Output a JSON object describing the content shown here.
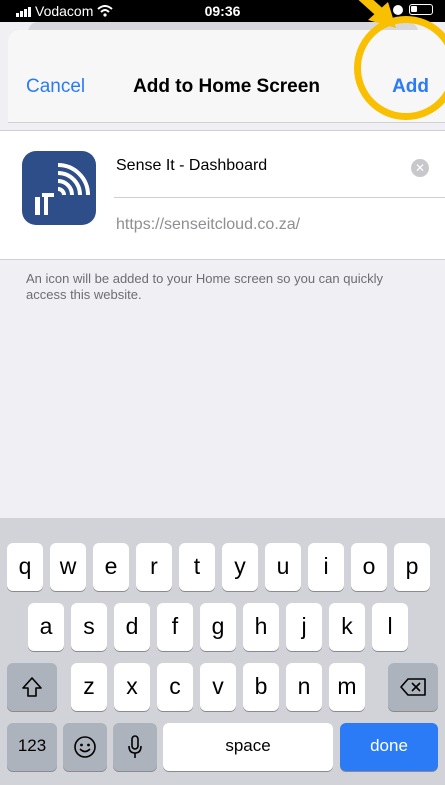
{
  "status_bar": {
    "carrier": "Vodacom",
    "time": "09:36"
  },
  "navbar": {
    "cancel_label": "Cancel",
    "title": "Add to Home Screen",
    "add_label": "Add"
  },
  "form": {
    "name_value": "Sense It - Dashboard",
    "url_value": "https://senseitcloud.co.za/",
    "note": "An icon will be added to your Home screen so you can quickly access this website."
  },
  "icons": {
    "app": "sense-it-wifi-logo",
    "clear": "clear-icon",
    "shift": "shift-icon",
    "backspace": "backspace-icon",
    "emoji": "emoji-icon",
    "mic": "microphone-icon"
  },
  "keyboard": {
    "row1": [
      "q",
      "w",
      "e",
      "r",
      "t",
      "y",
      "u",
      "i",
      "o",
      "p"
    ],
    "row2": [
      "a",
      "s",
      "d",
      "f",
      "g",
      "h",
      "j",
      "k",
      "l"
    ],
    "row3": [
      "z",
      "x",
      "c",
      "v",
      "b",
      "n",
      "m"
    ],
    "numbers_label": "123",
    "space_label": "space",
    "done_label": "done"
  },
  "colors": {
    "accent": "#2b7bf6",
    "highlight": "#f8c000",
    "app_icon_bg": "#2e4e8a"
  }
}
